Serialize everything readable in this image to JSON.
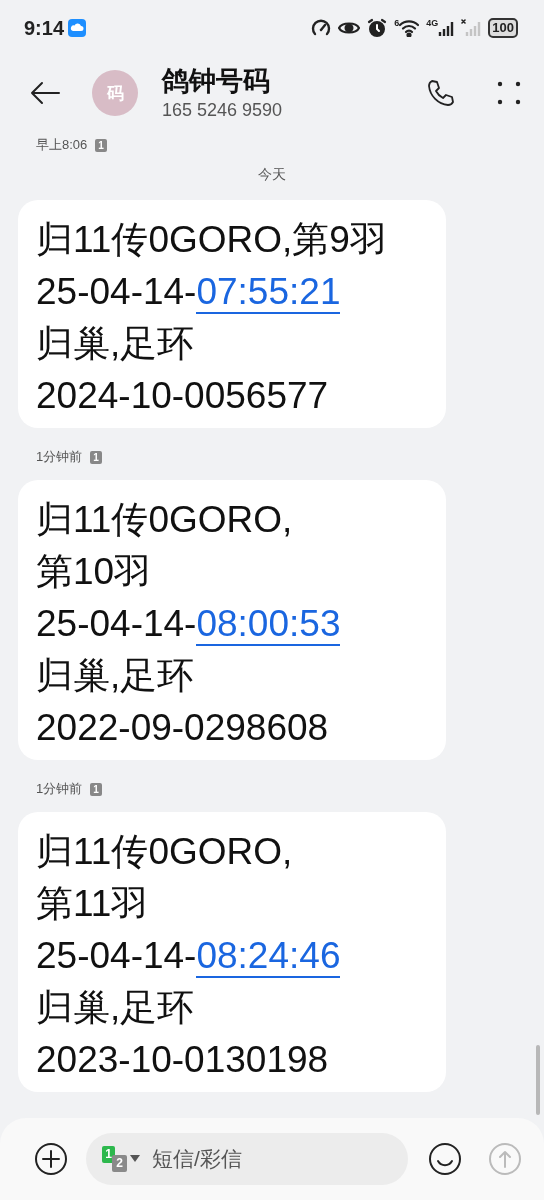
{
  "status_bar": {
    "time": "9:14",
    "wifi_label": "6",
    "network_label": "4G",
    "battery": "100"
  },
  "header": {
    "avatar": "码",
    "name": "鸽钟号码",
    "number": "165 5246 9590"
  },
  "items": [
    {
      "kind": "time",
      "text": "早上8:06",
      "sim": "1"
    },
    {
      "kind": "date",
      "text": "今天"
    },
    {
      "kind": "message",
      "lines": [
        {
          "text": "归11传0GORO,第9羽"
        },
        {
          "text": "25-04-14-",
          "link": "07:55:21"
        },
        {
          "text": "归巢,足环"
        },
        {
          "text": "2024-10-0056577"
        }
      ]
    },
    {
      "kind": "time",
      "text": "1分钟前",
      "sim": "1"
    },
    {
      "kind": "message",
      "lines": [
        {
          "text": "归11传0GORO,"
        },
        {
          "text": "第10羽"
        },
        {
          "text": "25-04-14-",
          "link": "08:00:53"
        },
        {
          "text": "归巢,足环"
        },
        {
          "text": "2022-09-0298608"
        }
      ]
    },
    {
      "kind": "time",
      "text": "1分钟前",
      "sim": "1"
    },
    {
      "kind": "message",
      "lines": [
        {
          "text": "归11传0GORO,"
        },
        {
          "text": "第11羽"
        },
        {
          "text": "25-04-14-",
          "link": "08:24:46"
        },
        {
          "text": "归巢,足环"
        },
        {
          "text": "2023-10-0130198"
        }
      ]
    }
  ],
  "composer": {
    "sim_badges": [
      "1",
      "2"
    ],
    "placeholder": "短信/彩信"
  }
}
